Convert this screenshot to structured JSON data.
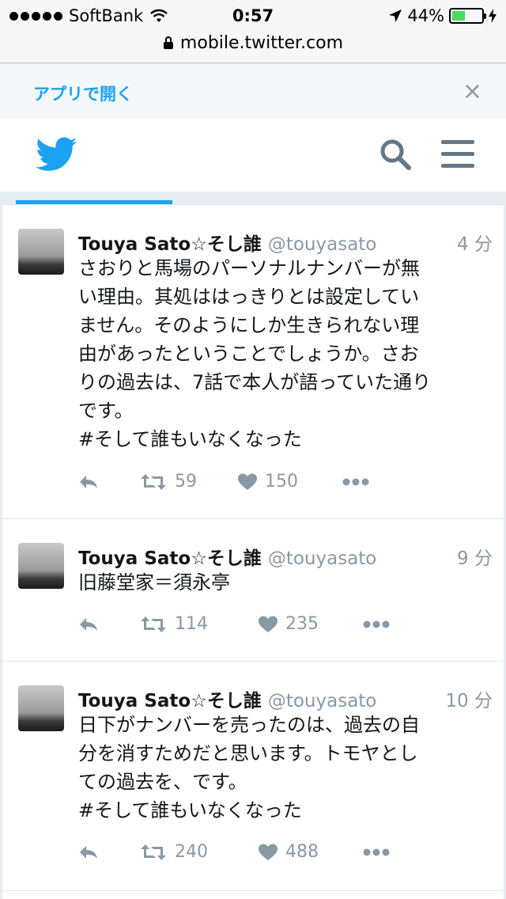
{
  "status_bar": {
    "carrier": "SoftBank",
    "time": "0:57",
    "battery": "44%",
    "battery_level": 0.44
  },
  "url_bar": {
    "url": "mobile.twitter.com"
  },
  "app_banner": {
    "open_label": "アプリで開く",
    "close_label": "×"
  },
  "tweets": [
    {
      "name": "Touya Sato☆そし誰",
      "handle": "@touyasato",
      "time": "4 分",
      "text": "さおりと馬場のパーソナルナンバーが無\nい理由。其処ははっきりとは設定してい\nません。そのようにしか生きられない理\n由があったということでしょうか。さお\nりの過去は、7話で本人が語っていた通り\nです。\n#そして誰もいなくなった",
      "retweets": "59",
      "likes": "150"
    },
    {
      "name": "Touya Sato☆そし誰",
      "handle": "@touyasato",
      "time": "9 分",
      "text": "旧藤堂家＝須永亭",
      "retweets": "114",
      "likes": "235"
    },
    {
      "name": "Touya Sato☆そし誰",
      "handle": "@touyasato",
      "time": "10 分",
      "text": "日下がナンバーを売ったのは、過去の自\n分を消すためだと思います。トモヤとし\nての過去を、です。\n#そして誰もいなくなった",
      "retweets": "240",
      "likes": "488"
    }
  ]
}
